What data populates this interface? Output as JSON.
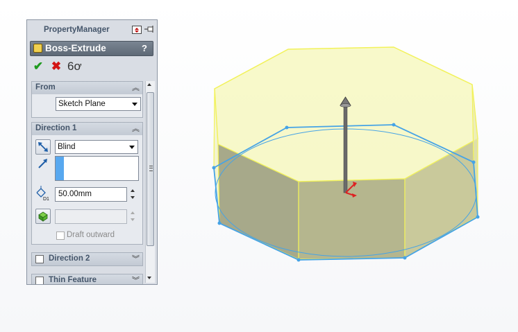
{
  "property_manager": {
    "title": "PropertyManager",
    "feature": {
      "title": "Boss-Extrude",
      "help": "?"
    },
    "actions": {
      "ok": "✔",
      "cancel": "✖",
      "preview": "6ơ"
    },
    "from": {
      "title": "From",
      "start_condition": "Sketch Plane"
    },
    "direction1": {
      "title": "Direction 1",
      "end_condition": "Blind",
      "depth_label": "D1",
      "depth": "50.00mm",
      "draft_outward_label": "Draft outward",
      "draft_outward_checked": false
    },
    "direction2": {
      "title": "Direction 2",
      "checked": false
    },
    "thin_feature": {
      "title": "Thin Feature",
      "checked": false
    }
  },
  "colors": {
    "preview_fill": "#f3f590",
    "preview_edge": "#f2f25a",
    "sketch_profile": "#45a3e6",
    "side_shading": "#a9a985",
    "arrow": "#6a6a6a"
  }
}
